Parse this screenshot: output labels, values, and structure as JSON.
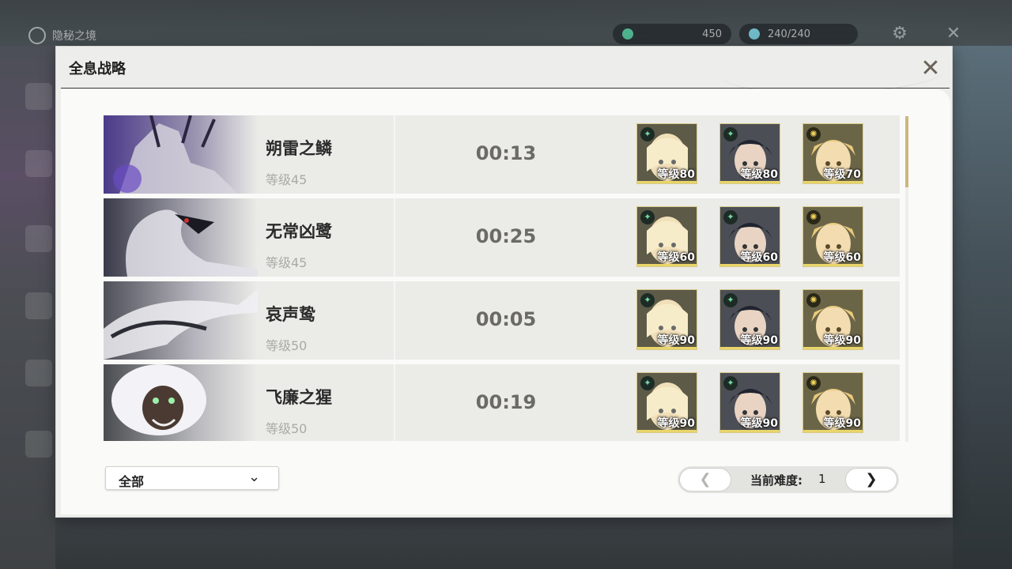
{
  "hud": {
    "back_label": "隐秘之境",
    "resource1": "450",
    "resource2": "240/240"
  },
  "dialog": {
    "title": "全息战略",
    "close_icon": "close-x-icon"
  },
  "rows": [
    {
      "boss_name": "朔雷之鳞",
      "boss_level": "等级45",
      "clear_time": "00:13",
      "team": [
        {
          "level": "等级80",
          "attribute": "aero-icon"
        },
        {
          "level": "等级80",
          "attribute": "aero-icon"
        },
        {
          "level": "等级70",
          "attribute": "spectro-icon"
        }
      ]
    },
    {
      "boss_name": "无常凶鹭",
      "boss_level": "等级45",
      "clear_time": "00:25",
      "team": [
        {
          "level": "等级60",
          "attribute": "aero-icon"
        },
        {
          "level": "等级60",
          "attribute": "aero-icon"
        },
        {
          "level": "等级60",
          "attribute": "spectro-icon"
        }
      ]
    },
    {
      "boss_name": "哀声鸷",
      "boss_level": "等级50",
      "clear_time": "00:05",
      "team": [
        {
          "level": "等级90",
          "attribute": "aero-icon"
        },
        {
          "level": "等级90",
          "attribute": "aero-icon"
        },
        {
          "level": "等级90",
          "attribute": "spectro-icon"
        }
      ]
    },
    {
      "boss_name": "飞廉之猩",
      "boss_level": "等级50",
      "clear_time": "00:19",
      "team": [
        {
          "level": "等级90",
          "attribute": "aero-icon"
        },
        {
          "level": "等级90",
          "attribute": "aero-icon"
        },
        {
          "level": "等级90",
          "attribute": "spectro-icon"
        }
      ]
    }
  ],
  "filter": {
    "selected": "全部"
  },
  "pager": {
    "prev": "❮",
    "next": "❯",
    "label": "当前难度:",
    "value": "1"
  },
  "colors": {
    "accent_gold": "#d6c98a",
    "aero_green": "#77d9a6",
    "spectro_yellow": "#f1d45b"
  }
}
